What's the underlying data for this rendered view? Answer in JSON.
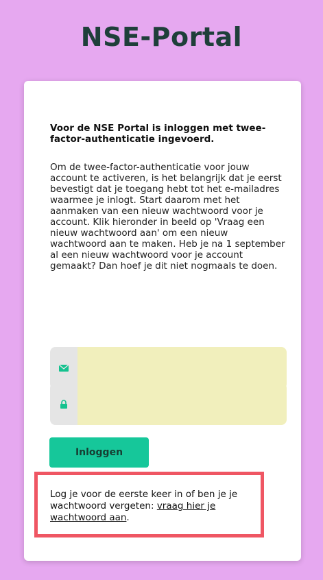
{
  "page": {
    "title": "NSE-Portal"
  },
  "intro": {
    "heading": "Voor de NSE Portal is inloggen met twee-factor-authenticatie ingevoerd.",
    "body": "Om de twee-factor-authenticatie voor jouw account te activeren, is het belangrijk dat je eerst bevestigt dat je toegang hebt tot het e-mailadres waarmee je inlogt. Start daarom met het aanmaken van een nieuw wachtwoord voor je account. Klik hieronder in beeld op 'Vraag een nieuw wachtwoord aan' om een nieuw wachtwoord aan te maken. Heb je na 1 september al een nieuw wachtwoord voor je account gemaakt? Dan hoef je dit niet nogmaals te doen."
  },
  "form": {
    "email_value": "",
    "password_value": "",
    "login_label": "Inloggen"
  },
  "help": {
    "text": "Log je voor de eerste keer in of ben je je wachtwoord vergeten: ",
    "link_text": "vraag hier je wachtwoord aan",
    "suffix": "."
  },
  "icons": {
    "email": "envelope-icon",
    "password": "lock-icon"
  },
  "colors": {
    "background": "#e6a8f0",
    "accent": "#16c79a",
    "input_bg": "#f1efbc",
    "highlight": "#ef5663"
  }
}
